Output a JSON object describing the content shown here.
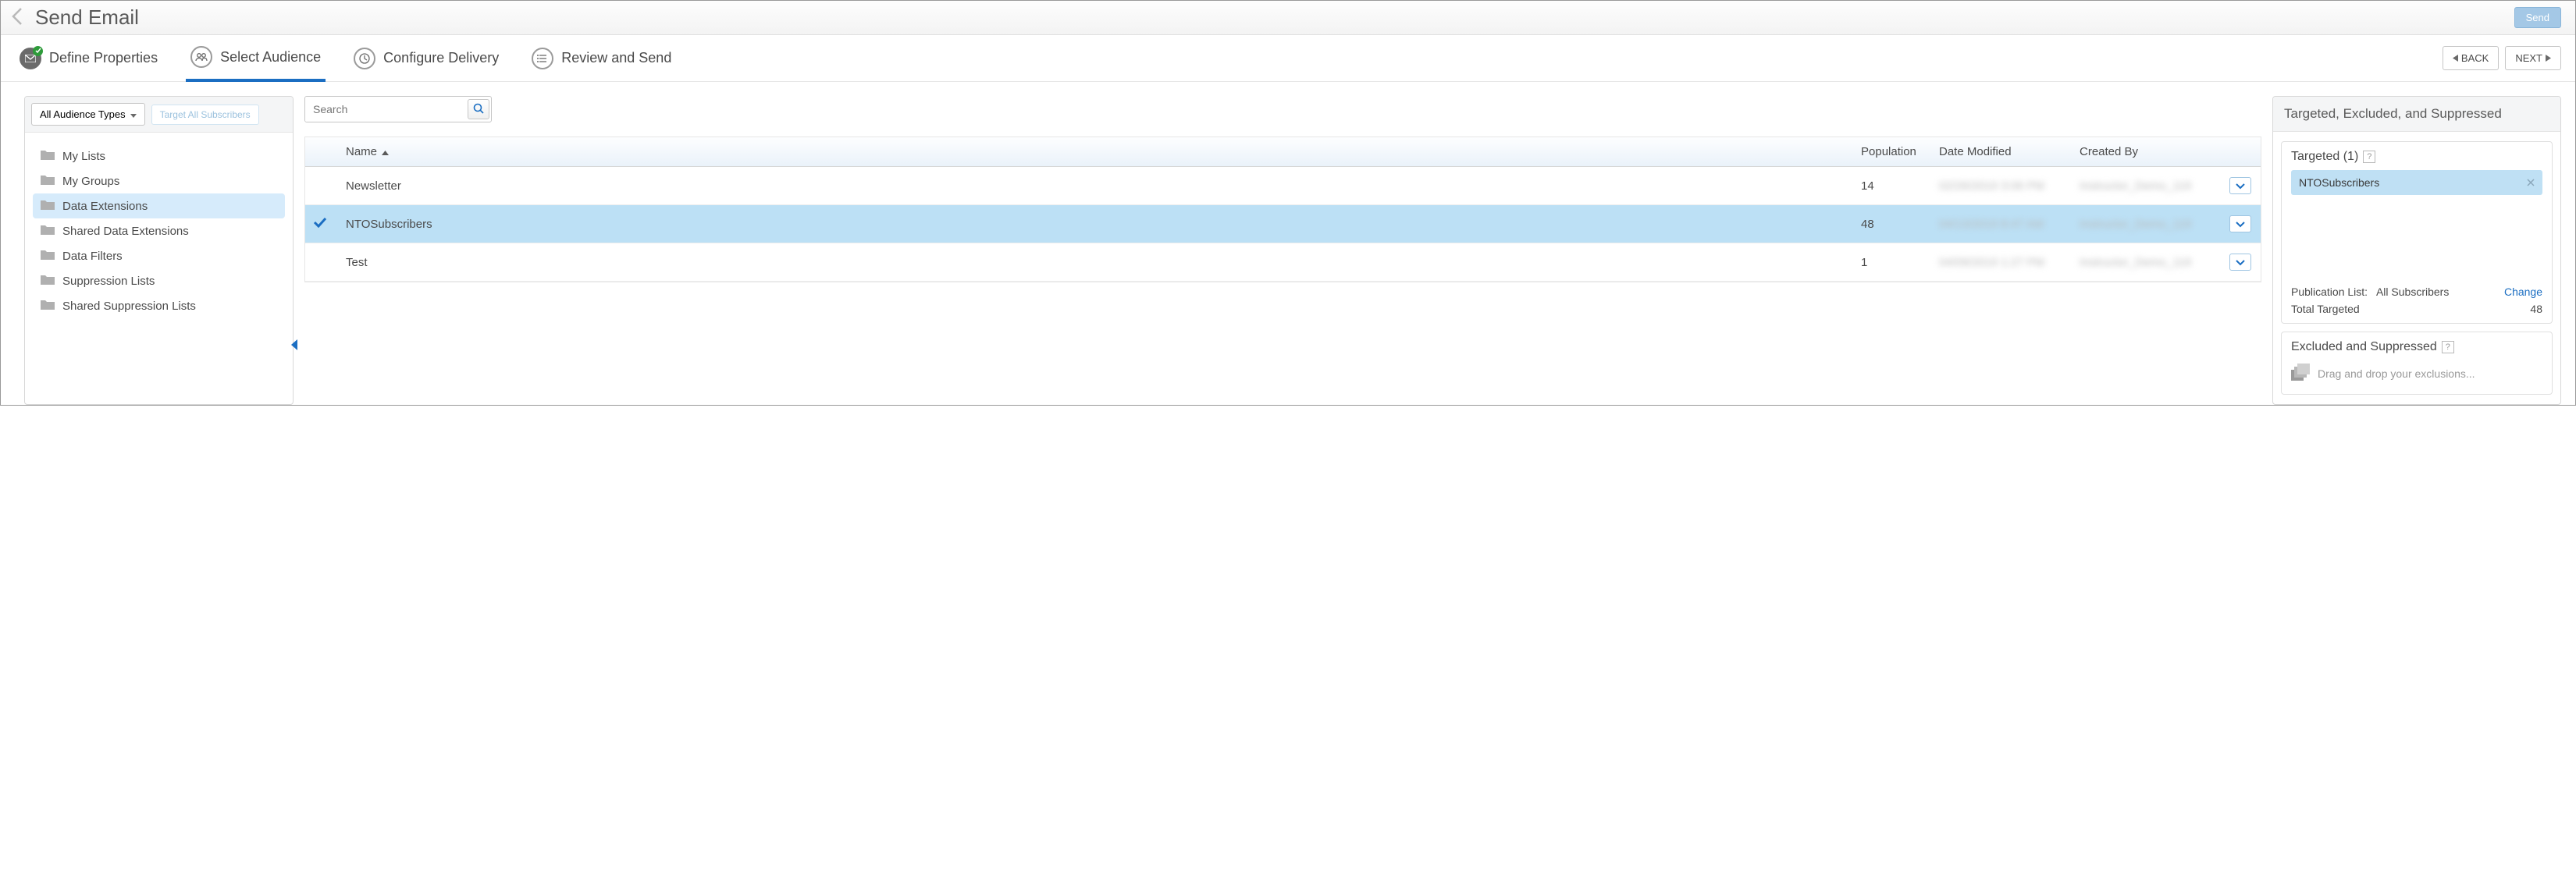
{
  "header": {
    "title": "Send Email",
    "send_label": "Send"
  },
  "steps": {
    "define": "Define Properties",
    "select": "Select Audience",
    "configure": "Configure Delivery",
    "review": "Review and Send",
    "back_label": "BACK",
    "next_label": "NEXT"
  },
  "sidebar": {
    "dropdown_label": "All Audience Types",
    "target_all_label": "Target All Subscribers",
    "folders": [
      {
        "label": "My Lists",
        "selected": false
      },
      {
        "label": "My Groups",
        "selected": false
      },
      {
        "label": "Data Extensions",
        "selected": true
      },
      {
        "label": "Shared Data Extensions",
        "selected": false
      },
      {
        "label": "Data Filters",
        "selected": false
      },
      {
        "label": "Suppression Lists",
        "selected": false
      },
      {
        "label": "Shared Suppression Lists",
        "selected": false
      }
    ]
  },
  "search": {
    "placeholder": "Search"
  },
  "table": {
    "columns": {
      "name": "Name",
      "population": "Population",
      "date": "Date Modified",
      "created_by": "Created By"
    },
    "rows": [
      {
        "name": "Newsletter",
        "population": "14",
        "date": "02/26/2019 3:06 PM",
        "created_by": "Instructor_Demo_119",
        "selected": false
      },
      {
        "name": "NTOSubscribers",
        "population": "48",
        "date": "04/13/2019 8:47 AM",
        "created_by": "Instructor_Demo_119",
        "selected": true
      },
      {
        "name": "Test",
        "population": "1",
        "date": "04/09/2019 1:27 PM",
        "created_by": "Instructor_Demo_119",
        "selected": false
      }
    ]
  },
  "right": {
    "header": "Targeted, Excluded, and Suppressed",
    "targeted": {
      "title": "Targeted (1)",
      "chips": [
        {
          "label": "NTOSubscribers"
        }
      ],
      "pub_list_label": "Publication List:",
      "pub_list_value": "All Subscribers",
      "change_label": "Change",
      "total_label": "Total Targeted",
      "total_value": "48"
    },
    "excluded": {
      "title": "Excluded and Suppressed",
      "dropzone": "Drag and drop your exclusions..."
    }
  }
}
